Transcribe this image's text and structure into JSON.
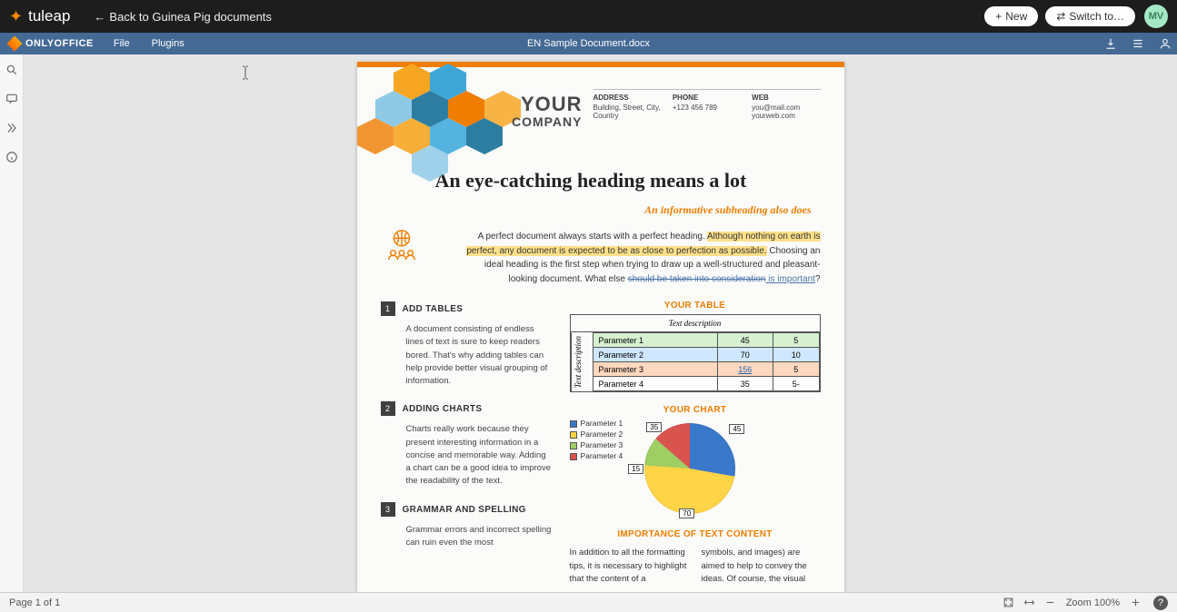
{
  "topbar": {
    "brand": "tuleap",
    "back_label": "Back to Guinea Pig documents",
    "new_label": "New",
    "switch_label": "Switch to…",
    "avatar_initials": "MV"
  },
  "appbar": {
    "app_name": "ONLYOFFICE",
    "menu": {
      "file": "File",
      "plugins": "Plugins"
    },
    "doc_title": "EN Sample Document.docx"
  },
  "document": {
    "company_line1": "YOUR",
    "company_line2": "COMPANY",
    "contacts": {
      "address_h": "ADDRESS",
      "address_v": "Building, Street, City, Country",
      "phone_h": "PHONE",
      "phone_v": "+123 456 789",
      "web_h": "WEB",
      "web_v1": "you@mail.com",
      "web_v2": "yourweb.com"
    },
    "h1_pre": "An eye-",
    "h1_bold": "catching",
    "h1_post": " heading means a lot",
    "subheading": "An informative subheading also does",
    "intro_p1": "A perfect document always starts with a perfect heading. ",
    "intro_hl": "Although nothing on earth is perfect, any document is expected to be as close to perfection as possible.",
    "intro_p2": " Choosing an ideal heading is the first step when trying to draw up a well-structured and pleasant-looking document. What else ",
    "intro_strike": "should be taken into consideration",
    "intro_imp": " is important",
    "intro_q": "?",
    "tips": [
      {
        "num": "1",
        "title": "ADD TABLES",
        "body": "A document consisting of endless lines of text is sure to keep readers bored. That's why adding tables can help provide better visual grouping of information."
      },
      {
        "num": "2",
        "title": "ADDING CHARTS",
        "body": "Charts really work because they present interesting information in a concise and memorable way. Adding a chart can be a good idea to improve the readability of the text."
      },
      {
        "num": "3",
        "title": "GRAMMAR AND SPELLING",
        "body": "Grammar errors and incorrect spelling can ruin even the most"
      }
    ],
    "table_section_title": "YOUR TABLE",
    "table_caption": "Text description",
    "table_side": "Text description",
    "table_rows": [
      {
        "p": "Parameter 1",
        "a": "45",
        "b": "5"
      },
      {
        "p": "Parameter 2",
        "a": "70",
        "b": "10"
      },
      {
        "p": "Parameter 3",
        "a": "156",
        "b": "5"
      },
      {
        "p": "Parameter 4",
        "a": "35",
        "b": "5-"
      }
    ],
    "chart_section_title": "YOUR CHART",
    "chart_legend": [
      "Parameter 1",
      "Parameter 2",
      "Parameter 3",
      "Parameter 4"
    ],
    "chart_labels": {
      "a": "45",
      "b": "70",
      "c": "15",
      "d": "35"
    },
    "importance_title": "IMPORTANCE OF TEXT CONTENT",
    "importance_col1": "In addition to all the formatting tips, it is necessary to highlight that the content of a",
    "importance_col2": "symbols, and images) are aimed to help to convey the ideas. Of course, the visual"
  },
  "chart_data": {
    "type": "pie",
    "title": "YOUR CHART",
    "series": [
      {
        "name": "Parameter 1",
        "value": 45,
        "color": "#3a78c9"
      },
      {
        "name": "Parameter 2",
        "value": 70,
        "color": "#ffd447"
      },
      {
        "name": "Parameter 3",
        "value": 15,
        "color": "#9fce63"
      },
      {
        "name": "Parameter 4",
        "value": 35,
        "color": "#d9534f"
      }
    ]
  },
  "statusbar": {
    "page_info": "Page 1 of 1",
    "zoom_label": "Zoom 100%"
  },
  "colors": {
    "legend": [
      "#3a78c9",
      "#ffd447",
      "#9fce63",
      "#d9534f"
    ]
  }
}
